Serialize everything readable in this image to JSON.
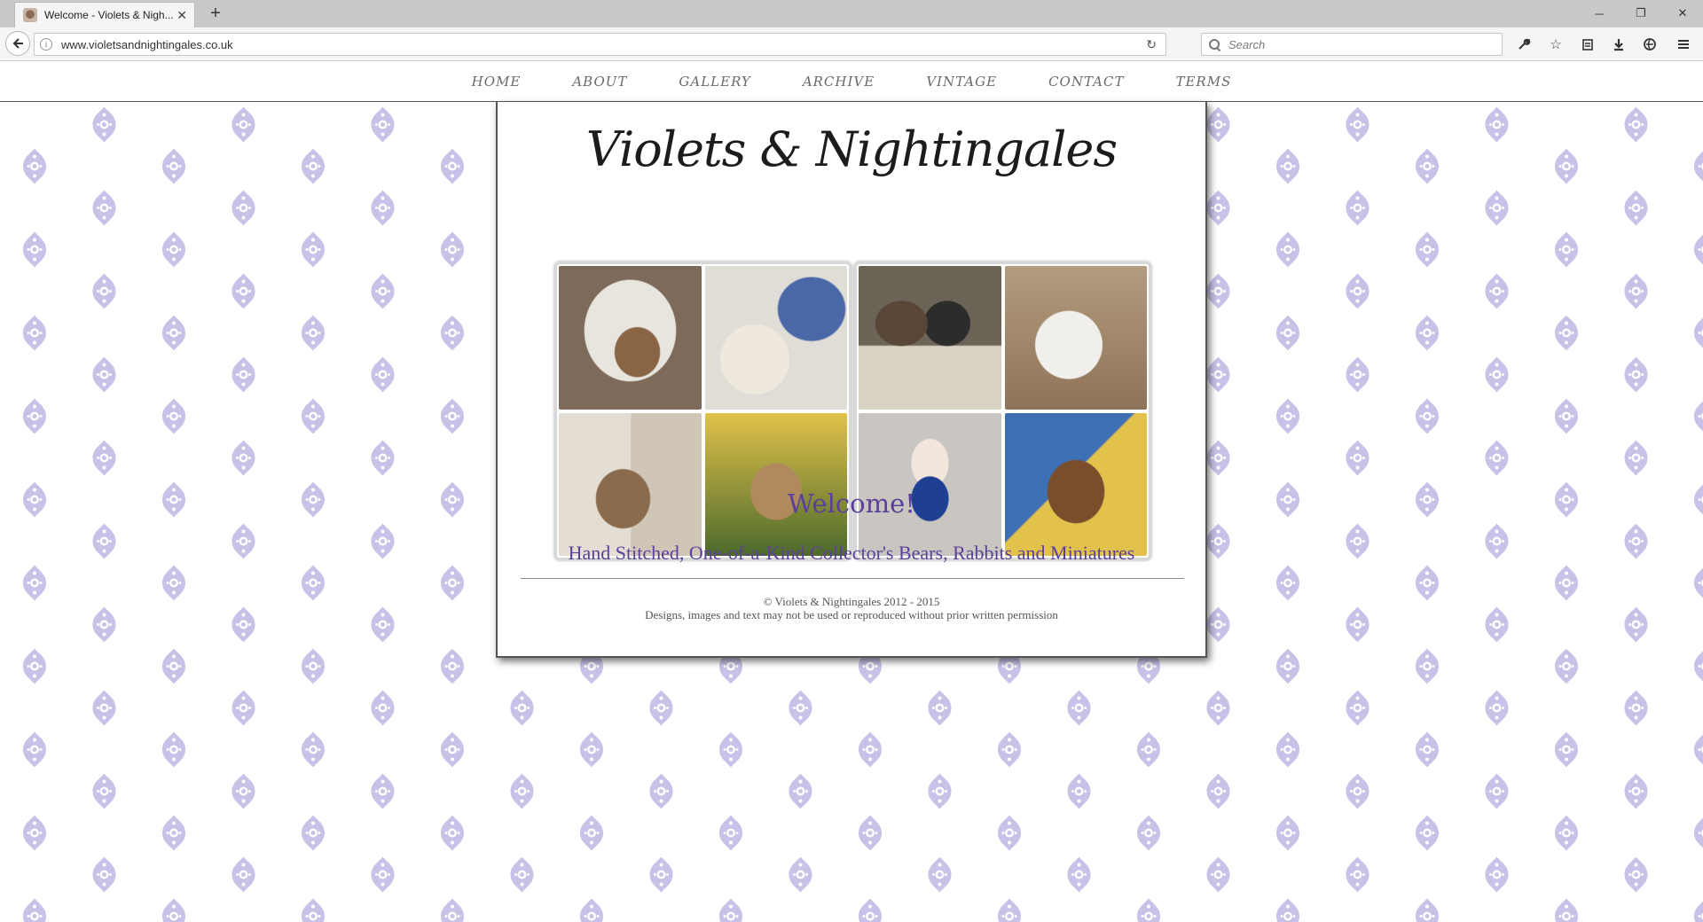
{
  "browser": {
    "tab_title": "Welcome - Violets & Nigh...",
    "new_tab": "+",
    "url": "www.violetsandnightingales.co.uk",
    "search_placeholder": "Search",
    "icons": [
      "back-arrow-icon",
      "info-icon",
      "reload-icon",
      "search-icon",
      "wrench-icon",
      "star-icon",
      "reading-list-icon",
      "download-icon",
      "vpn-icon",
      "menu-icon",
      "minimize-icon",
      "restore-icon",
      "close-window-icon"
    ]
  },
  "site": {
    "nav": [
      "HOME",
      "ABOUT",
      "GALLERY",
      "ARCHIVE",
      "VINTAGE",
      "CONTACT",
      "TERMS"
    ],
    "logo": "Violets & Nightingales",
    "welcome": "Welcome!",
    "tagline": "Hand Stitched, One-of-a-Kind Collector's Bears, Rabbits and Miniatures",
    "copyright": "© Violets & Nightingales 2012 - 2015",
    "notice": "Designs, images and text may not be used or reproduced without prior written permission",
    "accent_color": "#5b3f9a",
    "pattern_color": "#c7c3e8"
  }
}
